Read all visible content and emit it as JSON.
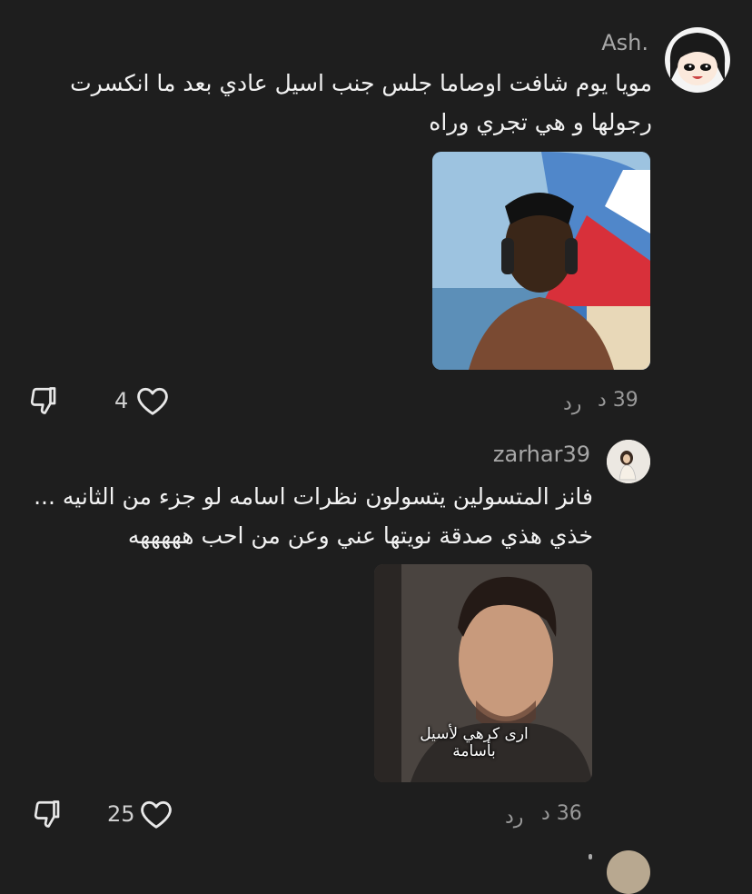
{
  "comments": [
    {
      "username": "Ash.",
      "text_line1": "مويا يوم شافت اوصاما جلس جنب اسيل عادي بعد ما انكسرت",
      "text_line2": "رجولها و هي تجري وراه",
      "likes": "4",
      "time": "39 د",
      "reply_label": "رد"
    },
    {
      "username": "zarhar39",
      "text_line1": "فانز المتسولين يتسولون نظرات اسامه لو جزء من الثانيه ...",
      "text_line2": "خذي هذي صدقة نويتها عني وعن من احب هههههه",
      "image_caption_line1": "ارى كرهي لأسيل",
      "image_caption_line2": "بأسامة",
      "likes": "25",
      "time": "36 د",
      "reply_label": "رد"
    }
  ],
  "colors": {
    "background": "#1e1e1e",
    "text": "#f2f2f2",
    "muted": "#9a9a9a"
  }
}
